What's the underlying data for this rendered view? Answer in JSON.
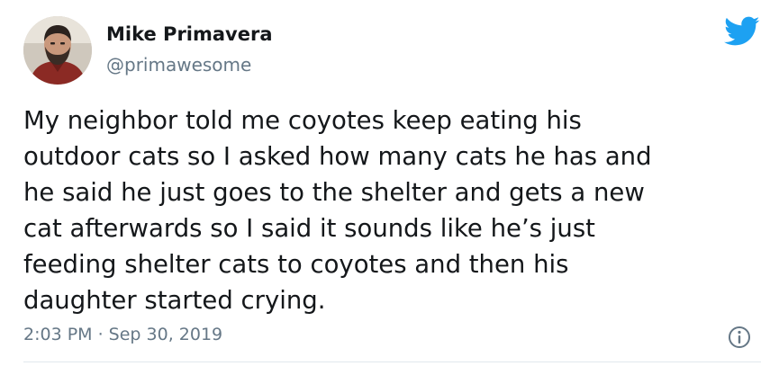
{
  "author": {
    "display_name": "Mike Primavera",
    "handle": "@primawesome"
  },
  "tweet": {
    "text_lines": [
      "My neighbor told me coyotes keep eating his",
      "outdoor cats so I asked how many cats he has and",
      "he said he just goes to the shelter and gets a new",
      "cat afterwards so I said it sounds like he’s just",
      "feeding shelter cats to coyotes and then his",
      "daughter started crying."
    ],
    "timestamp": "2:03 PM · Sep 30, 2019"
  },
  "icons": {
    "brand": "twitter-bird-icon",
    "info": "info-icon"
  },
  "colors": {
    "brand_blue": "#1DA1F2",
    "text_primary": "#14171A",
    "text_secondary": "#657786"
  }
}
